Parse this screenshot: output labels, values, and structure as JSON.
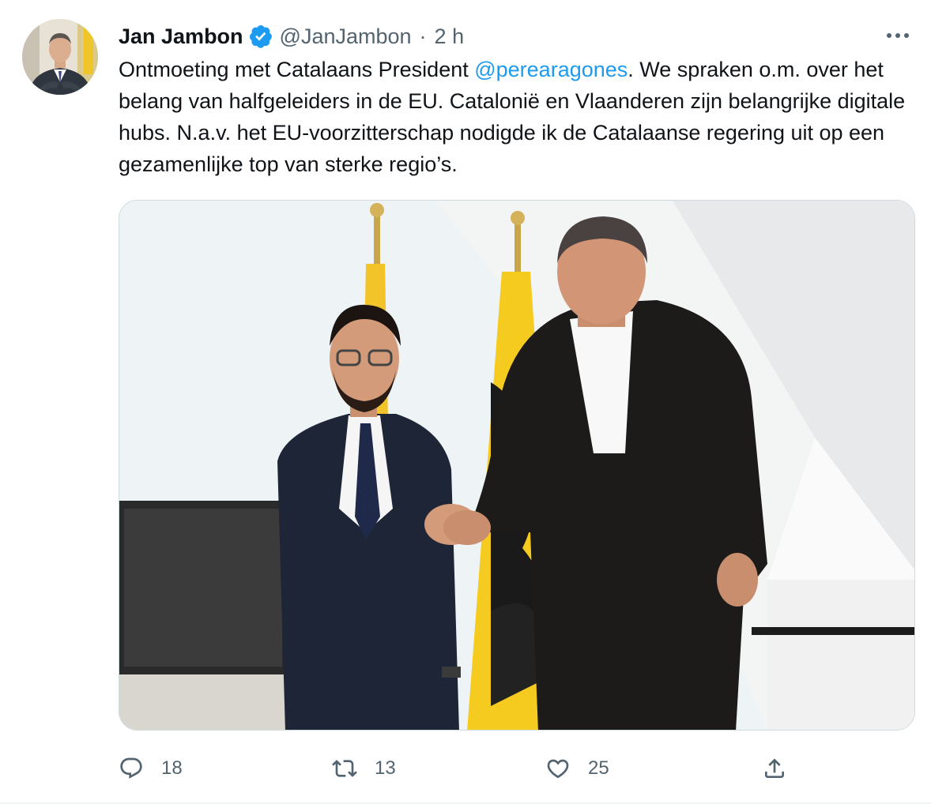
{
  "author": {
    "display_name": "Jan Jambon",
    "handle": "@JanJambon",
    "separator": "·",
    "time": "2 h",
    "verified_icon": "verified-badge-icon"
  },
  "tweet": {
    "text_before": "Ontmoeting met Catalaans President ",
    "mention": "@perearagones",
    "text_after": ". We spraken o.m. over het belang van halfgeleiders in de EU. Catalonië en Vlaanderen zijn belangrijke digitale hubs. N.a.v. het EU-voorzitterschap nodigde ik de Catalaanse regering uit op een gezamenlijke top van sterke regio’s."
  },
  "actions": {
    "reply": {
      "icon": "reply-icon",
      "count": "18"
    },
    "retweet": {
      "icon": "retweet-icon",
      "count": "13"
    },
    "like": {
      "icon": "like-icon",
      "count": "25"
    },
    "share": {
      "icon": "share-icon"
    }
  },
  "colors": {
    "accent": "#1d9bf0",
    "secondary_text": "#536471",
    "primary_text": "#0f1419"
  }
}
